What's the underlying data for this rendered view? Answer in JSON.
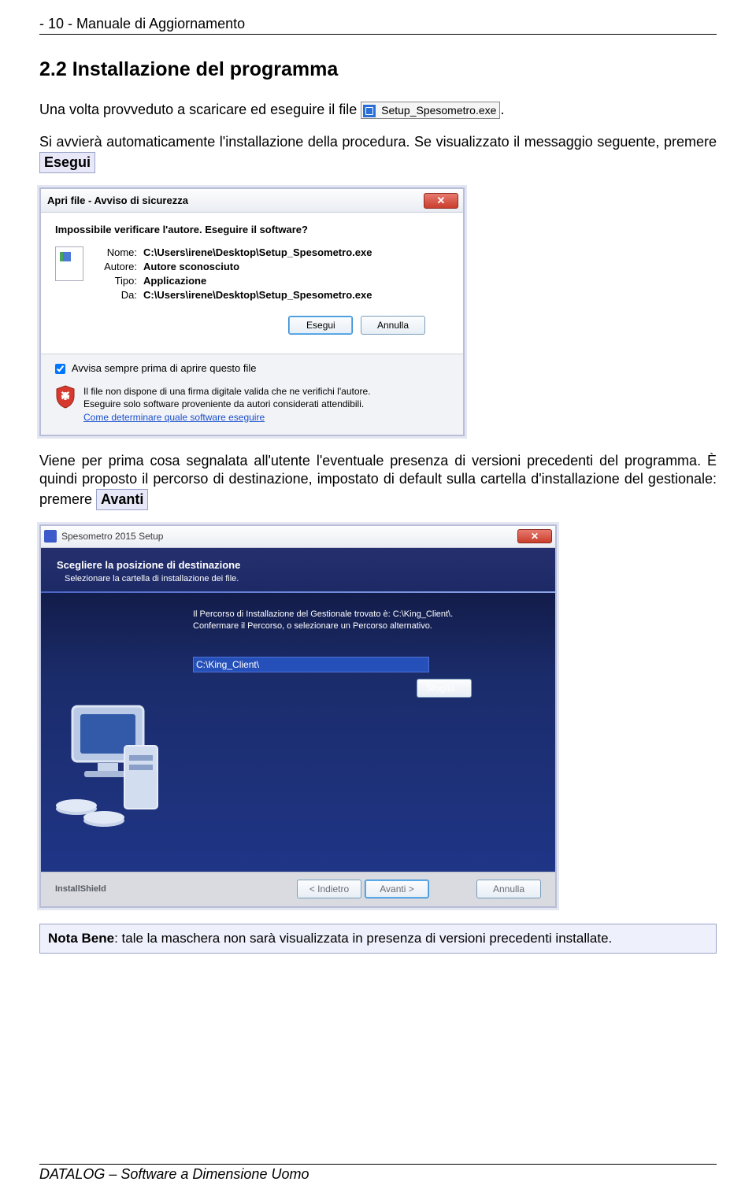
{
  "header": {
    "text": "- 10 -  Manuale di Aggiornamento"
  },
  "section": {
    "title": "2.2  Installazione del programma"
  },
  "para1": {
    "pre": "Una volta provveduto a scaricare ed eseguire il file ",
    "file_label": "Setup_Spesometro.exe",
    "post": "."
  },
  "para2": {
    "pre": "Si avvierà automaticamente l'installazione della procedura. Se visualizzato il messaggio seguente, premere ",
    "btn": "Esegui"
  },
  "security": {
    "title": "Apri file - Avviso di sicurezza",
    "question": "Impossibile verificare l'autore. Eseguire il software?",
    "rows": {
      "name_lbl": "Nome:",
      "name_val": "C:\\Users\\irene\\Desktop\\Setup_Spesometro.exe",
      "author_lbl": "Autore:",
      "author_val": "Autore sconosciuto",
      "type_lbl": "Tipo:",
      "type_val": "Applicazione",
      "from_lbl": "Da:",
      "from_val": "C:\\Users\\irene\\Desktop\\Setup_Spesometro.exe"
    },
    "btn_run": "Esegui",
    "btn_cancel": "Annulla",
    "checkbox": "Avvisa sempre prima di aprire questo file",
    "warn1": "Il file non dispone di una firma digitale valida che ne verifichi l'autore.",
    "warn2": "Eseguire solo software proveniente da autori considerati attendibili.",
    "link": "Come determinare quale software eseguire"
  },
  "para3": {
    "text1": "Viene per prima cosa segnalata all'utente l'eventuale presenza di versioni precedenti del programma. È quindi proposto il percorso di destinazione, impostato di default sulla cartella d'installazione del gestionale: premere ",
    "btn": "Avanti"
  },
  "installer": {
    "title": "Spesometro 2015 Setup",
    "h1": "Scegliere la posizione di destinazione",
    "h2": "Selezionare la cartella di installazione dei file.",
    "msg1": "Il Percorso di Installazione del Gestionale trovato è: C:\\King_Client\\.",
    "msg2": "Confermare il Percorso, o selezionare un Percorso alternativo.",
    "path": "C:\\King_Client\\",
    "browse": "Sfoglia...",
    "brand": "InstallShield",
    "btn_back": "< Indietro",
    "btn_next": "Avanti >",
    "btn_cancel": "Annulla"
  },
  "note": {
    "label": "Nota Bene",
    "text": ": tale la maschera non sarà visualizzata in presenza di versioni precedenti installate."
  },
  "footer": {
    "text": "DATALOG – Software a Dimensione Uomo"
  }
}
